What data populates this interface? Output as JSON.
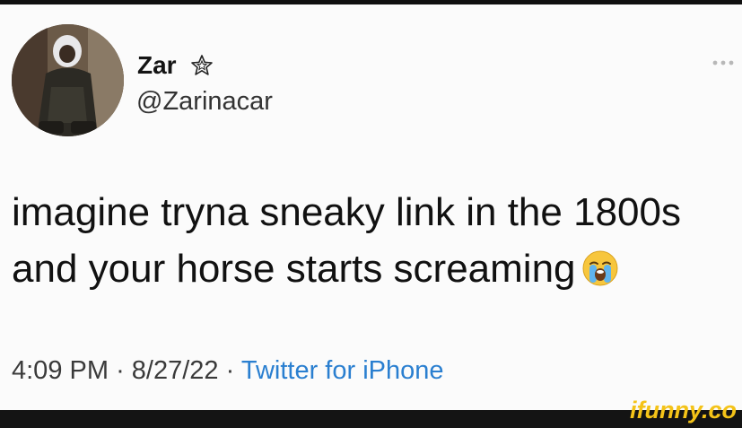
{
  "tweet": {
    "display_name": "Zar",
    "handle": "@Zarinacar",
    "text_lines": [
      "imagine tryna sneaky link in the 1800s",
      "and your horse starts screaming"
    ],
    "timestamp": "4:09 PM",
    "date": "8/27/22",
    "separator": "·",
    "source": "Twitter for iPhone"
  },
  "icons": {
    "badge": "star-icon",
    "emoji": "loudly-crying-face-icon",
    "menu": "more-options-icon"
  },
  "watermark": {
    "text": "ifunny.co"
  },
  "colors": {
    "link": "#2a7fd0",
    "watermark": "#f4c318",
    "bars": "#141414"
  }
}
